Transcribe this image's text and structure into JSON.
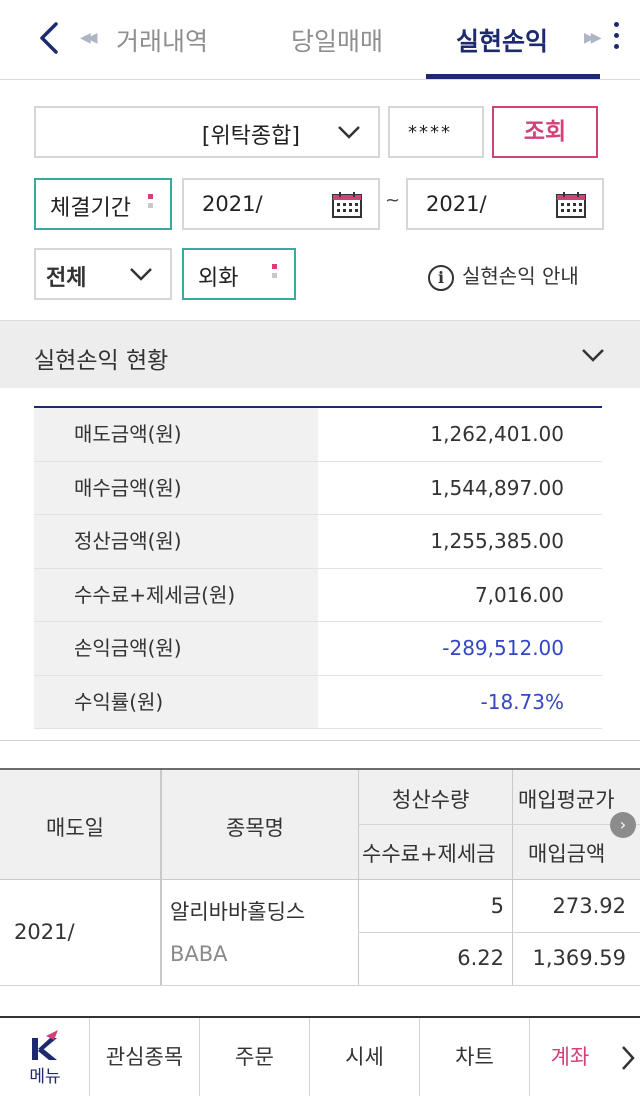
{
  "tabs": {
    "items": [
      "거래내역",
      "당일매매",
      "실현손익"
    ],
    "active": "실현손익",
    "accent": "#1d2b6e"
  },
  "filters": {
    "account_type": "[위탁종합]",
    "password_mask": "****",
    "search_label": "조회",
    "search_color": "#d1417a",
    "period_label": "체결기간",
    "date_from": "2021/",
    "date_separator": "~",
    "date_to": "2021/",
    "kind_select": "전체",
    "currency_label": "외화",
    "info_label": "실현손익 안내",
    "info_icon": "i"
  },
  "section": {
    "title": "실현손익 현황"
  },
  "summary": [
    {
      "label": "매도금액(원)",
      "value": "1,262,401.00",
      "negative": false
    },
    {
      "label": "매수금액(원)",
      "value": "1,544,897.00",
      "negative": false
    },
    {
      "label": "정산금액(원)",
      "value": "1,255,385.00",
      "negative": false
    },
    {
      "label": "수수료+제세금(원)",
      "value": "7,016.00",
      "negative": false
    },
    {
      "label": "손익금액(원)",
      "value": "-289,512.00",
      "negative": true
    },
    {
      "label": "수익률(원)",
      "value": "-18.73%",
      "negative": true
    }
  ],
  "trade_table": {
    "headers": {
      "sell_date": "매도일",
      "stock_name": "종목명",
      "settle_qty": "청산수량",
      "fee_tax": "수수료+제세금",
      "avg_buy_price": "매입평균가",
      "buy_amount": "매입금액"
    },
    "rows": [
      {
        "sell_date": "2021/",
        "stock_name": "알리바바홀딩스",
        "ticker": "BABA",
        "settle_qty": "5",
        "avg_buy_price": "273.92",
        "fee_tax": "6.22",
        "buy_amount": "1,369.59"
      }
    ]
  },
  "bottom_nav": {
    "menu_label": "메뉴",
    "items": [
      "관심종목",
      "주문",
      "시세",
      "차트",
      "계좌"
    ],
    "active": "계좌"
  }
}
